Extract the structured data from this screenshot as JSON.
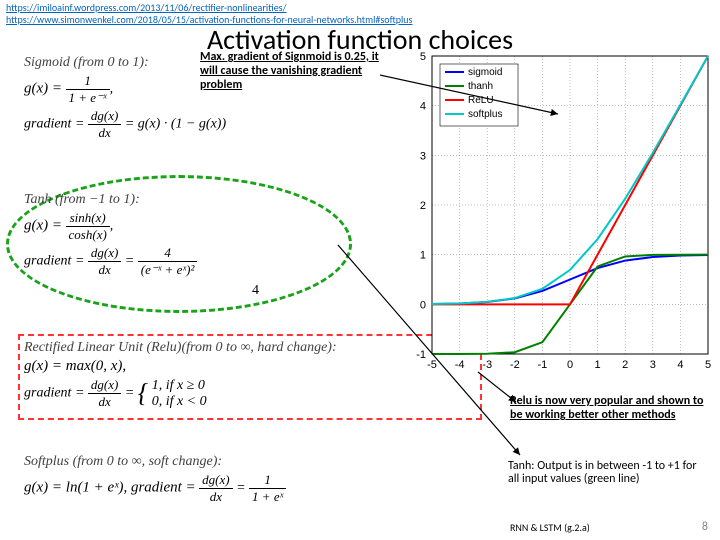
{
  "refs": {
    "url1": "https://imiloainf.wordpress.com/2013/11/06/rectifier-nonlinearities/",
    "url2": "https://www.simonwenkel.com/2018/05/15/activation-functions-for-neural-networks.html#softplus"
  },
  "title": "Activation function choices",
  "annotations": {
    "sigmoid": "Max. gradient of Signmoid is 0.25, it will cause the vanishing gradient problem",
    "relu": "Relu is now very popular and shown to be working better other methods",
    "tanh": "Tanh: Output is in between -1 to +1 for all input values (green line)"
  },
  "formulas": {
    "sigmoid": {
      "head": "Sigmoid (from 0 to 1):",
      "g": "g(x) =",
      "g_num": "1",
      "g_den": "1 + e⁻ˣ",
      "grad": "gradient =",
      "grad_num": "dg(x)",
      "grad_den": "dx",
      "grad_rhs": "= g(x) · (1 − g(x))"
    },
    "tanh": {
      "head": "Tanh (from −1 to 1):",
      "g": "g(x) =",
      "g_num": "sinh(x)",
      "g_den": "cosh(x)",
      "grad": "gradient =",
      "grad_num": "dg(x)",
      "grad_den": "dx",
      "grad_rhs1": "=",
      "grad_rhs_num": "4",
      "grad_rhs_den": "(e⁻ˣ + eˣ)²"
    },
    "relu": {
      "head": "Rectified Linear Unit (Relu)(from 0 to ∞, hard change):",
      "g": "g(x) = max(0, x),",
      "grad": "gradient =",
      "grad_num": "dg(x)",
      "grad_den": "dx",
      "eq": "=",
      "brace1": "1,    if x ≥ 0",
      "brace0": "0,    if x < 0"
    },
    "softplus": {
      "head": "Softplus (from 0 to ∞, soft change):",
      "g": "g(x) = ln(1 + eˣ), gradient =",
      "grad_num": "dg(x)",
      "grad_den": "dx",
      "eq": "=",
      "rhs_num": "1",
      "rhs_den": "1 + eˣ"
    }
  },
  "stray4": "4",
  "footer": "RNN & LSTM (g.2.a)",
  "pagenum": "8",
  "chart_data": {
    "type": "line",
    "title": "",
    "xlabel": "",
    "ylabel": "",
    "xlim": [
      -5,
      5
    ],
    "ylim": [
      -1,
      5
    ],
    "xticks": [
      -5,
      -4,
      -3,
      -2,
      -1,
      0,
      1,
      2,
      3,
      4,
      5
    ],
    "yticks": [
      -1,
      0,
      1,
      2,
      3,
      4,
      5
    ],
    "x": [
      -5,
      -4,
      -3,
      -2,
      -1,
      0,
      1,
      2,
      3,
      4,
      5
    ],
    "series": [
      {
        "name": "sigmoid",
        "color": "#0000ff",
        "values": [
          0.007,
          0.018,
          0.047,
          0.119,
          0.269,
          0.5,
          0.731,
          0.881,
          0.953,
          0.982,
          0.993
        ]
      },
      {
        "name": "thanh",
        "color": "#008000",
        "values": [
          -1.0,
          -0.999,
          -0.995,
          -0.964,
          -0.762,
          0.0,
          0.762,
          0.964,
          0.995,
          0.999,
          1.0
        ]
      },
      {
        "name": "ReLU",
        "color": "#ff0000",
        "values": [
          0,
          0,
          0,
          0,
          0,
          0,
          1,
          2,
          3,
          4,
          5
        ]
      },
      {
        "name": "softplus",
        "color": "#00c8c8",
        "values": [
          0.007,
          0.018,
          0.049,
          0.127,
          0.313,
          0.693,
          1.313,
          2.127,
          3.049,
          4.018,
          5.007
        ]
      }
    ],
    "legend_pos": "top-left"
  }
}
